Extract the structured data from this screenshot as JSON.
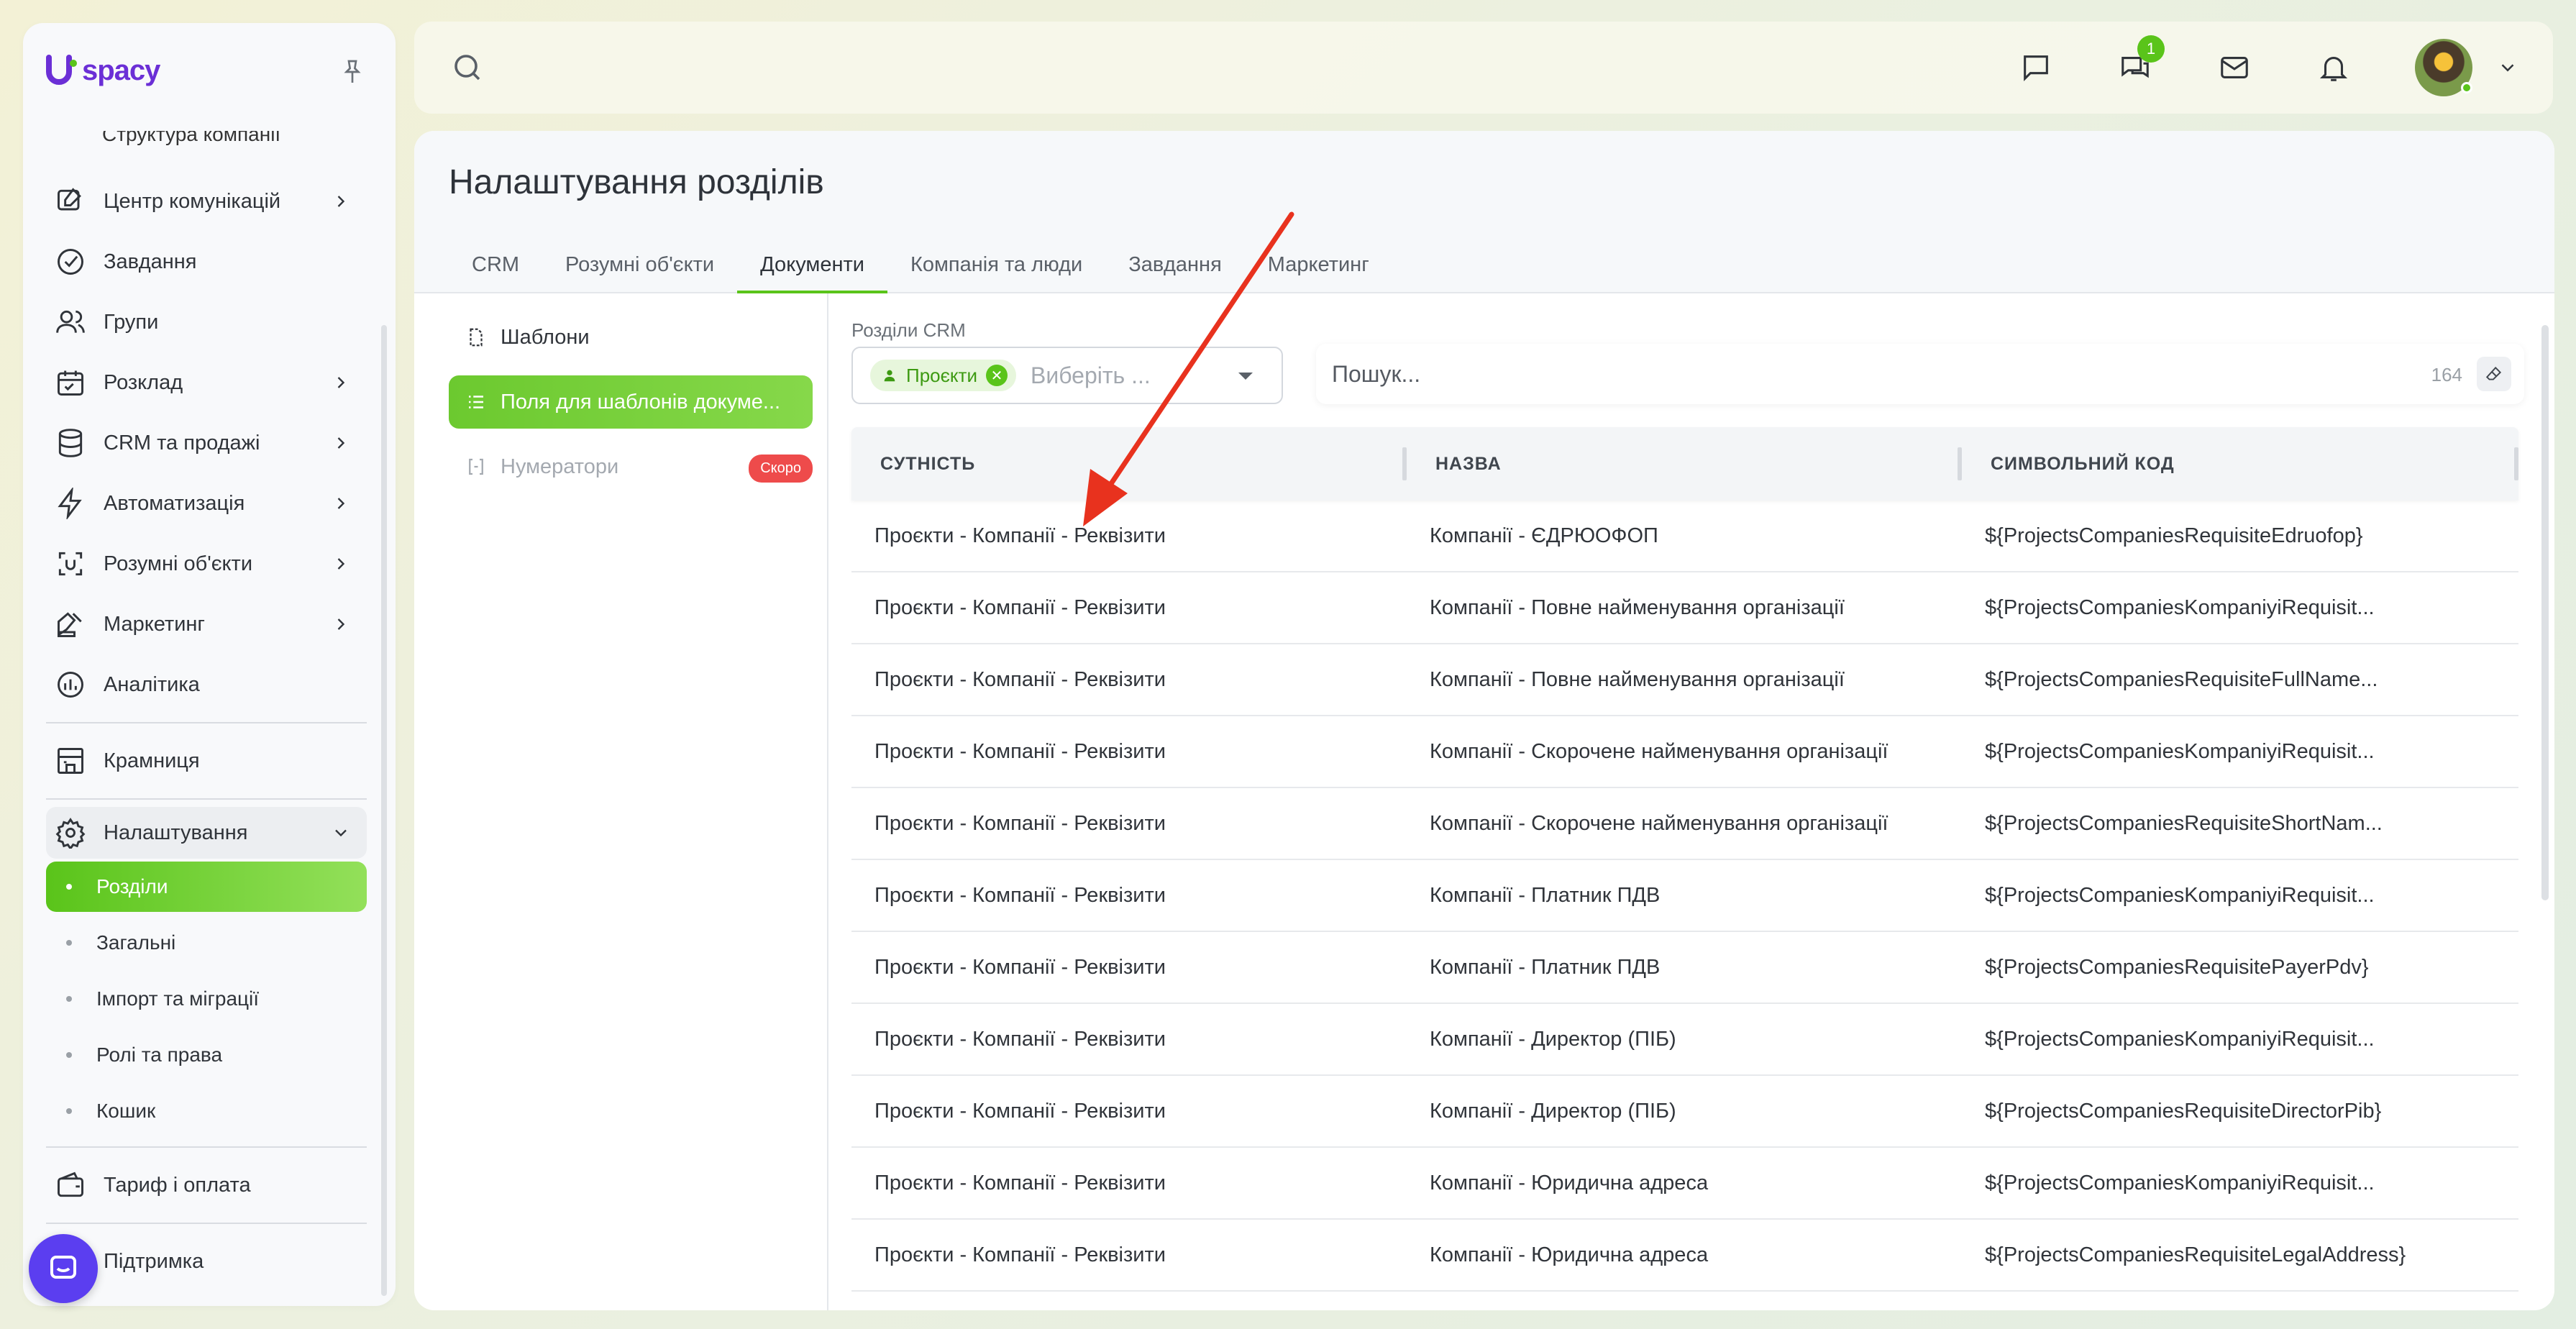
{
  "app": {
    "logo_text": "spacy",
    "brand_color": "#6b2fd6",
    "accent_color": "#5ac41a"
  },
  "sidebar": {
    "cut_item": "Структура компанії",
    "items": [
      {
        "label": "Центр комунікацій",
        "icon": "chat-edit-icon",
        "has_children": true
      },
      {
        "label": "Завдання",
        "icon": "check-circle-icon",
        "has_children": false
      },
      {
        "label": "Групи",
        "icon": "users-icon",
        "has_children": false
      },
      {
        "label": "Розклад",
        "icon": "calendar-icon",
        "has_children": true
      },
      {
        "label": "CRM та продажі",
        "icon": "database-icon",
        "has_children": true
      },
      {
        "label": "Автоматизація",
        "icon": "lightning-icon",
        "has_children": true
      },
      {
        "label": "Розумні об'єкти",
        "icon": "smart-object-icon",
        "has_children": true
      },
      {
        "label": "Маркетинг",
        "icon": "marketing-icon",
        "has_children": true
      },
      {
        "label": "Аналітика",
        "icon": "analytics-icon",
        "has_children": false
      }
    ],
    "store": "Крамниця",
    "settings": {
      "label": "Налаштування",
      "children": [
        "Розділи",
        "Загальні",
        "Імпорт та міграції",
        "Ролі та права",
        "Кошик"
      ],
      "active_index": 0
    },
    "billing": "Тариф і оплата",
    "support": "Підтримка"
  },
  "topbar": {
    "notifications_badge": "1"
  },
  "page": {
    "title": "Налаштування розділів",
    "tabs": [
      "CRM",
      "Розумні об'єкти",
      "Документи",
      "Компанія та люди",
      "Завдання",
      "Маркетинг"
    ],
    "active_tab": 2
  },
  "left_menu": {
    "items": [
      {
        "label": "Шаблони"
      },
      {
        "label": "Поля для шаблонів докуме..."
      },
      {
        "label": "Нумератори"
      }
    ],
    "soon_badge": "Скоро"
  },
  "filter": {
    "label": "Розділи CRM",
    "chip": "Проєкти",
    "placeholder": "Виберіть ..."
  },
  "search": {
    "placeholder": "Пошук...",
    "count": "164"
  },
  "table": {
    "columns": [
      "СУТНІСТЬ",
      "НАЗВА",
      "СИМВОЛЬНИЙ КОД"
    ],
    "rows": [
      [
        "Проєкти - Компанії - Реквізити",
        "Компанії - ЄДРЮОФОП",
        "${ProjectsCompaniesRequisiteEdruofop}"
      ],
      [
        "Проєкти - Компанії - Реквізити",
        "Компанії - Повне найменування організації",
        "${ProjectsCompaniesKompaniyiRequisit..."
      ],
      [
        "Проєкти - Компанії - Реквізити",
        "Компанії - Повне найменування організації",
        "${ProjectsCompaniesRequisiteFullName..."
      ],
      [
        "Проєкти - Компанії - Реквізити",
        "Компанії - Скорочене найменування організації",
        "${ProjectsCompaniesKompaniyiRequisit..."
      ],
      [
        "Проєкти - Компанії - Реквізити",
        "Компанії - Скорочене найменування організації",
        "${ProjectsCompaniesRequisiteShortNam..."
      ],
      [
        "Проєкти - Компанії - Реквізити",
        "Компанії - Платник ПДВ",
        "${ProjectsCompaniesKompaniyiRequisit..."
      ],
      [
        "Проєкти - Компанії - Реквізити",
        "Компанії - Платник ПДВ",
        "${ProjectsCompaniesRequisitePayerPdv}"
      ],
      [
        "Проєкти - Компанії - Реквізити",
        "Компанії - Директор (ПІБ)",
        "${ProjectsCompaniesKompaniyiRequisit..."
      ],
      [
        "Проєкти - Компанії - Реквізити",
        "Компанії - Директор (ПІБ)",
        "${ProjectsCompaniesRequisiteDirectorPib}"
      ],
      [
        "Проєкти - Компанії - Реквізити",
        "Компанії - Юридична адреса",
        "${ProjectsCompaniesKompaniyiRequisit..."
      ],
      [
        "Проєкти - Компанії - Реквізити",
        "Компанії - Юридична адреса",
        "${ProjectsCompaniesRequisiteLegalAddress}"
      ]
    ]
  },
  "annotation": {
    "arrow_color": "#e8321e"
  }
}
